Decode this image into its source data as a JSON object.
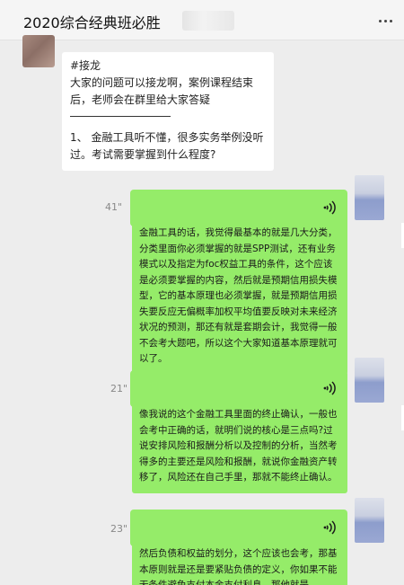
{
  "window": {
    "title": "2020综合经典班必胜"
  },
  "incoming": {
    "lines": [
      "#接龙",
      "大家的问题可以接龙啊，案例课程结束后，老师会在群里给大家答疑",
      "1、 金融工具听不懂，很多实务举例没听过。考试需要掌握到什么程度?"
    ]
  },
  "voice_messages": [
    {
      "duration": "41\"",
      "transcript": "金融工具的话，我觉得最基本的就是几大分类，分类里面你必须掌握的就是SPP测试，还有业务模式以及指定为foc权益工具的条件，这个应该是必须要掌握的内容，然后就是预期信用损失模型，它的基本原理也必须掌握，就是预期信用损失要反应无偏概率加权平均值要反映对未来经济状况的预测，那还有就是套期会计，我觉得一般不会考大题吧，所以这个大家知道基本原理就可以了。"
    },
    {
      "duration": "21\"",
      "transcript": "像我说的这个金融工具里面的终止确认，一般也会考中正确的话，就明们说的核心是三点吗?过说安排风险和报酬分析以及控制的分析，当然考得多的主要还是风险和报酬，就说你金融资产转移了，风险还在自己手里，那就不能终止确认。"
    },
    {
      "duration": "23\"",
      "transcript": "然后负债和权益的划分，这个应该也会考，那基本原则就是还是要紧贴负债的定义，你如果不能无条件避免支付本金支付利息，那他就是"
    }
  ],
  "colors": {
    "green_bubble": "#95ec69",
    "background": "#ededed"
  }
}
